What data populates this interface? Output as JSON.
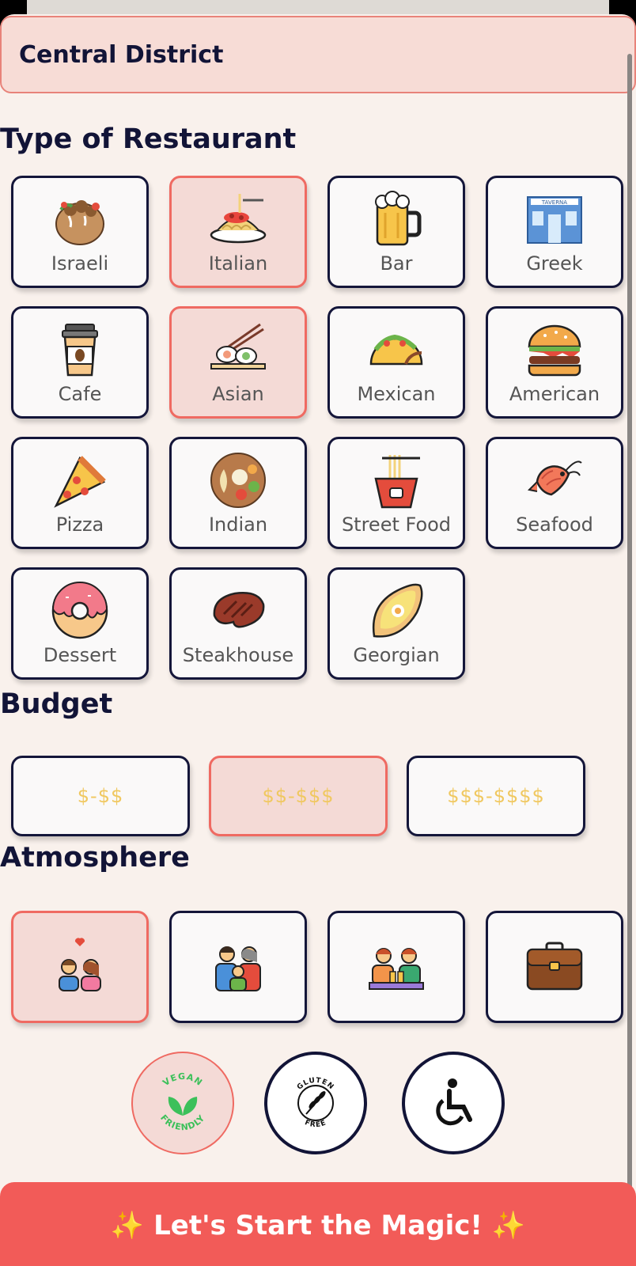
{
  "district": "Central District",
  "sections": {
    "restaurant_type": "Type of Restaurant",
    "budget": "Budget",
    "atmosphere": "Atmosphere"
  },
  "restaurant_types": [
    {
      "label": "Israeli",
      "icon": "falafel-pita-icon",
      "selected": false
    },
    {
      "label": "Italian",
      "icon": "spaghetti-icon",
      "selected": true
    },
    {
      "label": "Bar",
      "icon": "beer-mug-icon",
      "selected": false
    },
    {
      "label": "Greek",
      "icon": "taverna-icon",
      "selected": false
    },
    {
      "label": "Cafe",
      "icon": "coffee-cup-icon",
      "selected": false
    },
    {
      "label": "Asian",
      "icon": "sushi-chopsticks-icon",
      "selected": true
    },
    {
      "label": "Mexican",
      "icon": "taco-icon",
      "selected": false
    },
    {
      "label": "American",
      "icon": "burger-icon",
      "selected": false
    },
    {
      "label": "Pizza",
      "icon": "pizza-slice-icon",
      "selected": false
    },
    {
      "label": "Indian",
      "icon": "curry-plate-icon",
      "selected": false
    },
    {
      "label": "Street Food",
      "icon": "noodle-box-icon",
      "selected": false
    },
    {
      "label": "Seafood",
      "icon": "shrimp-icon",
      "selected": false
    },
    {
      "label": "Dessert",
      "icon": "donut-icon",
      "selected": false
    },
    {
      "label": "Steakhouse",
      "icon": "steak-icon",
      "selected": false
    },
    {
      "label": "Georgian",
      "icon": "khachapuri-icon",
      "selected": false
    }
  ],
  "budget": [
    {
      "label": "$-$$",
      "selected": false
    },
    {
      "label": "$$-$$$",
      "selected": true
    },
    {
      "label": "$$$-$$$$",
      "selected": false
    }
  ],
  "atmosphere": [
    {
      "icon": "couple-heart-icon",
      "selected": true
    },
    {
      "icon": "family-icon",
      "selected": false
    },
    {
      "icon": "friends-drinks-icon",
      "selected": false
    },
    {
      "icon": "briefcase-icon",
      "selected": false
    }
  ],
  "badges": {
    "vegan": {
      "top": "VEGAN",
      "bottom": "FRIENDLY",
      "selected": true
    },
    "gluten": {
      "top": "GLUTEN",
      "bottom": "FREE",
      "selected": false
    },
    "accessible": {
      "icon": "wheelchair-icon",
      "selected": false
    }
  },
  "cta": {
    "label": "Let's Start the Magic!",
    "sparkle": "✨"
  },
  "colors": {
    "accent": "#f25b58",
    "selected_bg": "#f4dad6",
    "selected_border": "#ef6a62",
    "card_border": "#14163a",
    "budget_text": "#f0c860",
    "page_bg": "#f9f1ec"
  }
}
